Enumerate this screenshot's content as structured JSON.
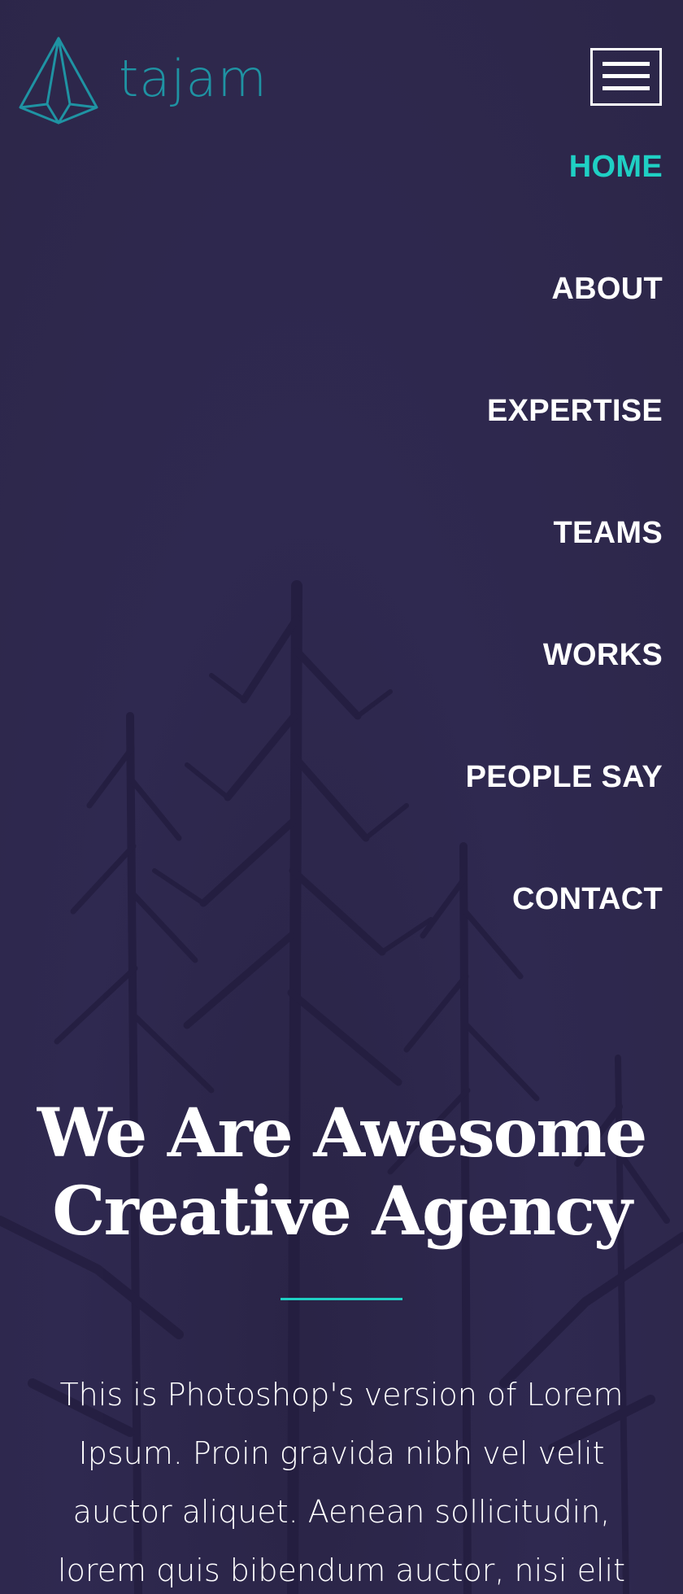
{
  "brand": {
    "name": "tajam",
    "logo_icon": "paper-plane-icon",
    "accent_color": "#1fd0c4",
    "logo_color": "#1f93a3"
  },
  "header": {
    "menu_icon": "hamburger-menu-icon"
  },
  "nav": {
    "items": [
      {
        "label": "HOME",
        "active": true
      },
      {
        "label": "ABOUT",
        "active": false
      },
      {
        "label": "EXPERTISE",
        "active": false
      },
      {
        "label": "TEAMS",
        "active": false
      },
      {
        "label": "WORKS",
        "active": false
      },
      {
        "label": "PEOPLE SAY",
        "active": false
      },
      {
        "label": "CONTACT",
        "active": false
      }
    ]
  },
  "hero": {
    "title_line1": "We Are Awesome",
    "title_line2": "Creative Agency",
    "text": "This is Photoshop's version of Lorem Ipsum. Proin gravida nibh vel velit auctor aliquet. Aenean sollicitudin, lorem quis bibendum auctor, nisi elit consequat"
  },
  "colors": {
    "background": "#2d2748",
    "text": "#ffffff"
  }
}
